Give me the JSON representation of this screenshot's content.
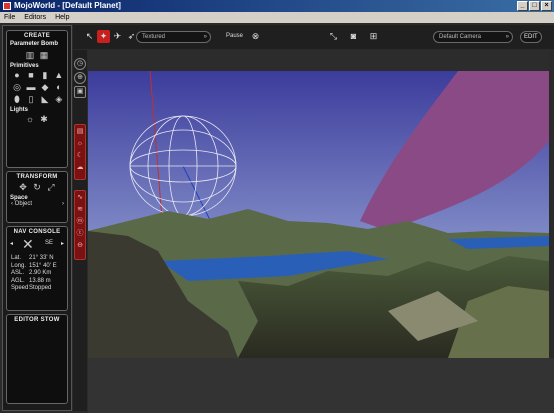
{
  "window": {
    "title": "MojoWorld - [Default Planet]"
  },
  "menu": [
    "File",
    "Editors",
    "Help"
  ],
  "create": {
    "header": "CREATE",
    "param_bomb": "Parameter Bomb",
    "primitives": "Primitives",
    "lights": "Lights"
  },
  "transform": {
    "header": "TRANSFORM",
    "space_label": "Space",
    "space_value": "Object"
  },
  "nav": {
    "header": "NAV CONSOLE",
    "heading": "SE",
    "lat_label": "Lat.",
    "lat": "21° 33' N",
    "long_label": "Long.",
    "long": "151° 40' E",
    "asl_label": "ASL.",
    "asl": "2.90 Km",
    "agl_label": "AGL.",
    "agl": "13.88 m",
    "speed_label": "Speed",
    "speed": "Stopped"
  },
  "stow": {
    "header": "EDITOR STOW"
  },
  "toolbar": {
    "render_mode": "Textured",
    "pause": "Pause",
    "camera": "Default Camera",
    "edit": "EDIT"
  },
  "colors": {
    "sky_top": "#3c3c9c",
    "sky_bottom": "#a8b4d8",
    "water": "#2a5fb8",
    "ribbon": "#8a4a86",
    "accent": "#c8201e"
  },
  "icons": [
    "pointer-icon",
    "walker-icon",
    "plane-icon",
    "rocket-icon",
    "pan-icon",
    "camera-icon",
    "grid-icon",
    "compass-icon",
    "globe-icon"
  ]
}
